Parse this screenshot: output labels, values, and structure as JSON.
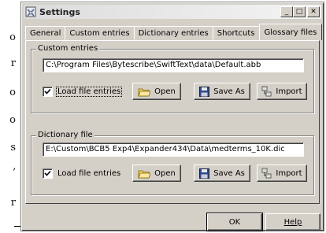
{
  "background_doc": {
    "chars": [
      "o",
      "r",
      "o",
      "o",
      "s",
      "’",
      "r"
    ]
  },
  "window": {
    "title": "Settings",
    "controls": {
      "minimize": "_",
      "maximize": "□",
      "close": "✕"
    }
  },
  "tabs": [
    {
      "label": "General",
      "active": false
    },
    {
      "label": "Custom entries",
      "active": false
    },
    {
      "label": "Dictionary entries",
      "active": false
    },
    {
      "label": "Shortcuts",
      "active": false
    },
    {
      "label": "Glossary files",
      "active": true
    }
  ],
  "custom_entries": {
    "legend": "Custom entries",
    "path": "C:\\Program Files\\Bytescribe\\SwiftText\\data\\Default.abb",
    "load_label": "Load file entries",
    "load_checked": true,
    "open_label": "Open",
    "save_as_label": "Save As",
    "import_label": "Import"
  },
  "dictionary_file": {
    "legend": "Dictionary file",
    "path": "E:\\Custom\\BCB5 Exp4\\Expander434\\Data\\medterms_10K.dic",
    "load_label": "Load file entries",
    "load_checked": true,
    "open_label": "Open",
    "save_as_label": "Save As",
    "import_label": "Import"
  },
  "footer": {
    "ok_label": "OK",
    "help_label": "Help"
  },
  "colors": {
    "face": "#d4d0c8",
    "field": "#ffffff",
    "shadow": "#808080"
  }
}
